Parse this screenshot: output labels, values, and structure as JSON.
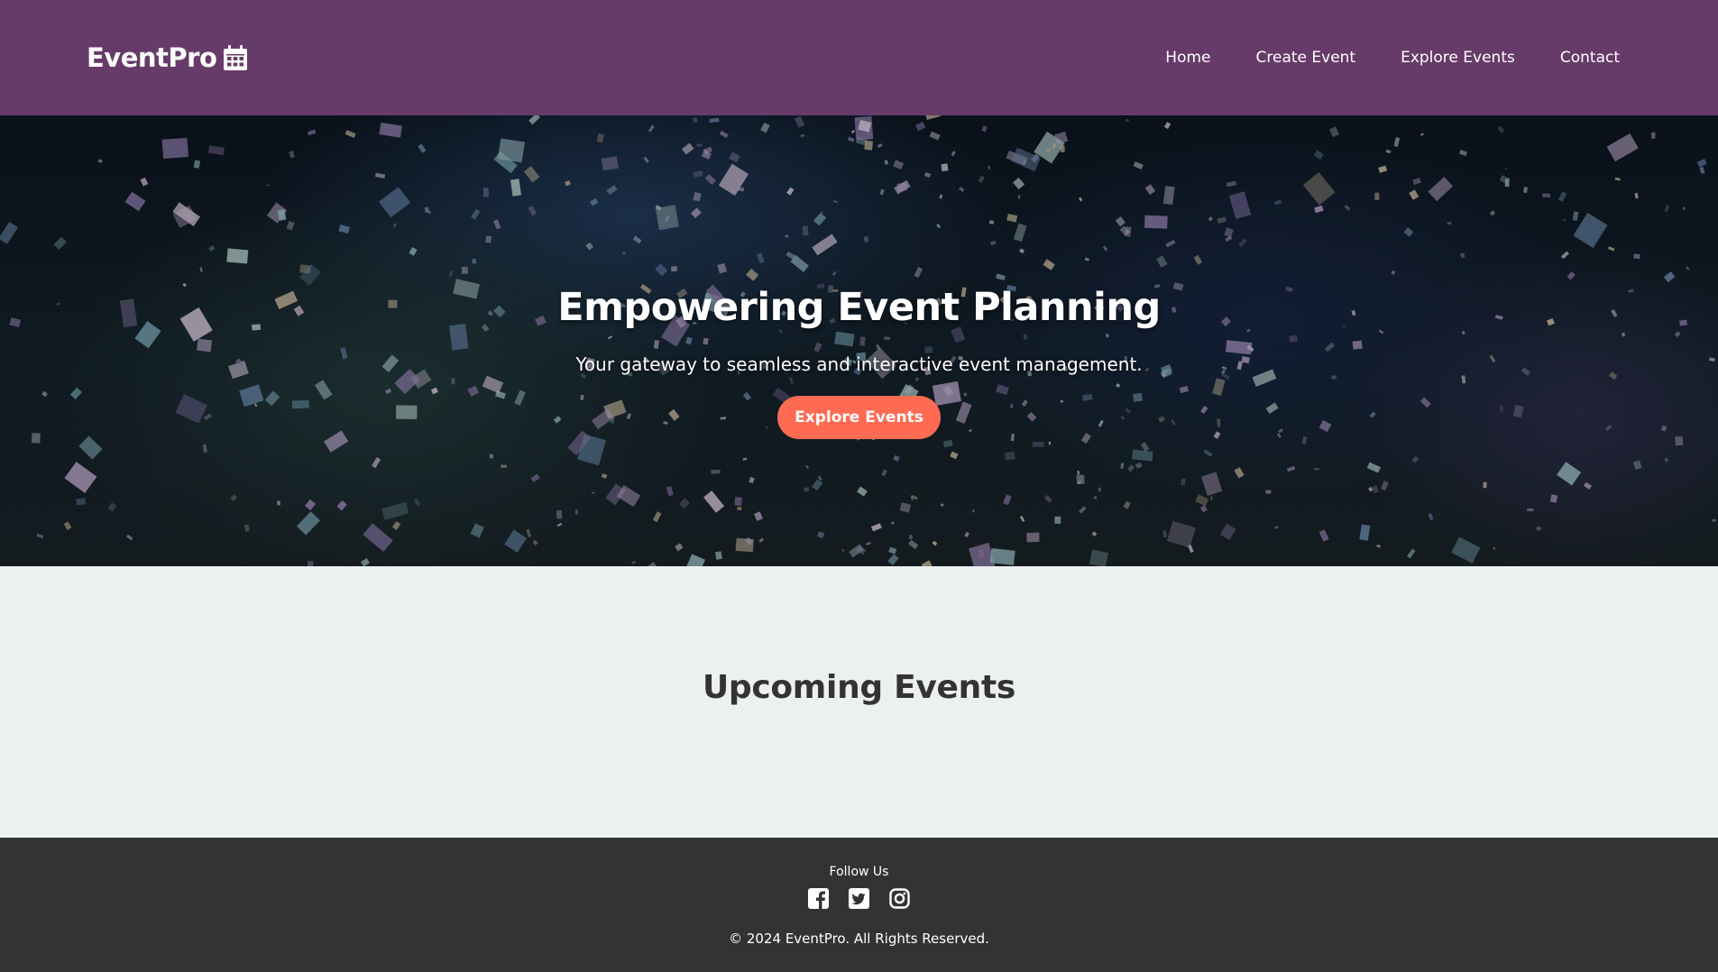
{
  "navbar": {
    "brand": "EventPro",
    "brand_icon": "calendar-icon",
    "links": [
      {
        "label": "Home"
      },
      {
        "label": "Create Event"
      },
      {
        "label": "Explore Events"
      },
      {
        "label": "Contact"
      }
    ],
    "background_color": "#673b69"
  },
  "hero": {
    "title": "Empowering Event Planning",
    "subtitle": "Your gateway to seamless and interactive event management.",
    "button_label": "Explore Events",
    "button_color": "#ff6b52",
    "background": "confetti-photo"
  },
  "upcoming": {
    "title": "Upcoming Events"
  },
  "footer": {
    "follow_label": "Follow Us",
    "social_icons": [
      "facebook-icon",
      "twitter-icon",
      "instagram-icon"
    ],
    "copyright": "© 2024 EventPro. All Rights Reserved.",
    "background_color": "#333333"
  }
}
